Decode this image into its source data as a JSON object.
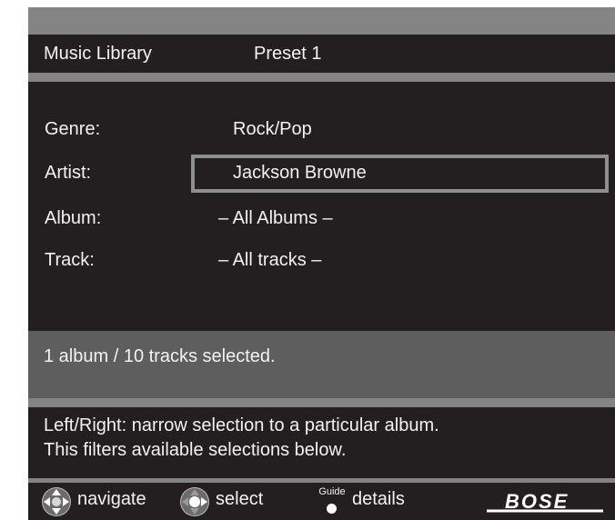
{
  "header": {
    "title": "Music Library",
    "preset": "Preset 1"
  },
  "fields": {
    "genre": {
      "label": "Genre:",
      "value": "Rock/Pop"
    },
    "artist": {
      "label": "Artist:",
      "value": "Jackson Browne"
    },
    "album": {
      "label": "Album:",
      "value": "– All Albums –"
    },
    "track": {
      "label": "Track:",
      "value": "– All tracks –"
    }
  },
  "status": {
    "text": "1 album / 10 tracks selected."
  },
  "hint": {
    "line1": "Left/Right: narrow selection to a particular album.",
    "line2": "This filters available selections below."
  },
  "footer": {
    "navigate_icon": "dpad-navigate-icon",
    "navigate_label": "navigate",
    "select_icon": "dpad-select-icon",
    "select_label": "select",
    "guide_key_text": "Guide",
    "details_label": "details",
    "brand": "BOSE"
  },
  "colors": {
    "screen_frame": "#848484",
    "panel_bg": "#231f20",
    "status_bg": "#5e5e5e",
    "highlight_border": "#8e8e8e",
    "text": "#f2f2f2"
  }
}
